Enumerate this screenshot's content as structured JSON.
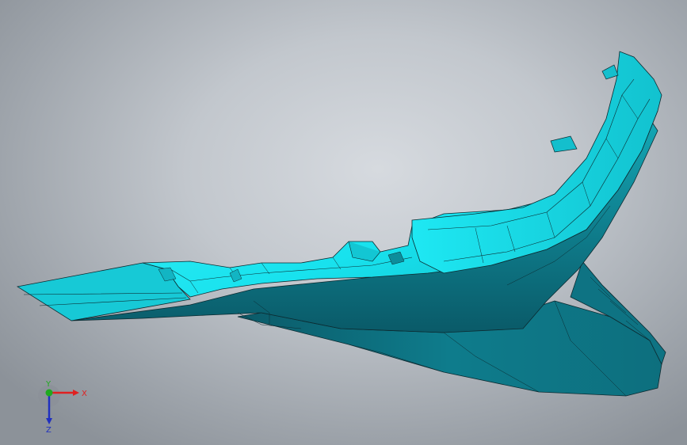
{
  "viewport": {
    "background": "#b9bec4"
  },
  "model": {
    "fill_light": "#19e9f2",
    "fill_mid": "#12b6c2",
    "fill_dark": "#0b6b78",
    "edge_color": "#0c2a30"
  },
  "triad": {
    "x_label": "X",
    "y_label": "Y",
    "z_label": "Z",
    "x_color": "#e02020",
    "y_color": "#1faa1f",
    "z_color": "#2030c0"
  }
}
